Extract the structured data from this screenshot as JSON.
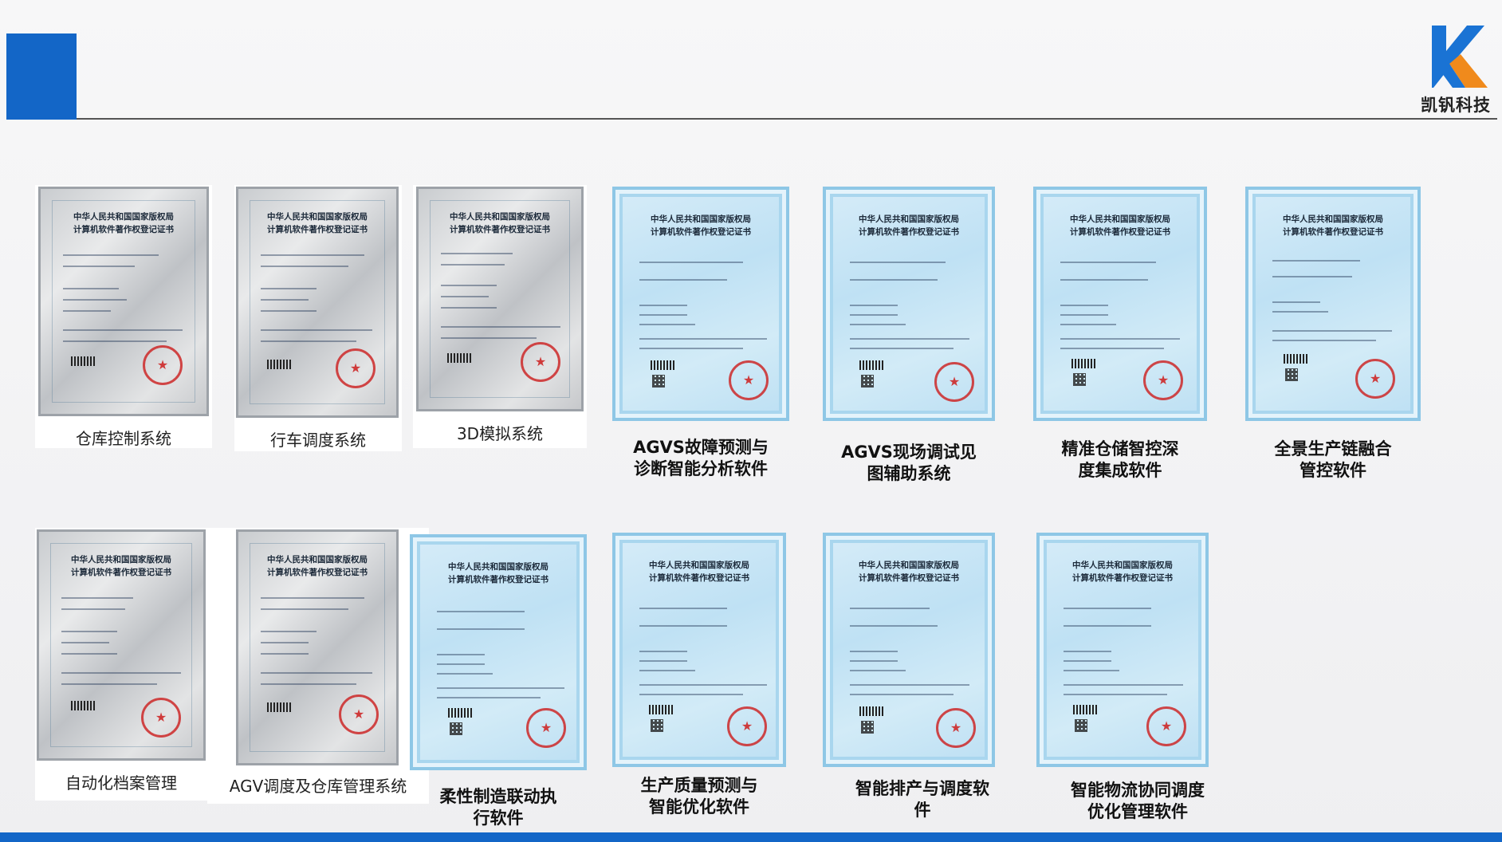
{
  "brand": {
    "logo_text": "凯钒科技",
    "colors": {
      "accent": "#1366c7",
      "logo_blue": "#1a73d4",
      "logo_orange": "#f08a1c"
    }
  },
  "certificates": {
    "gray_title_line1": "中华人民共和国国家版权局",
    "gray_title_line2": "计算机软件著作权登记证书",
    "blue_title_line1": "中华人民共和国国家版权局",
    "blue_title_line2": "计算机软件著作权登记证书",
    "row1": [
      {
        "style": "gray",
        "caption_lines": [
          "仓库控制系统"
        ]
      },
      {
        "style": "gray",
        "caption_lines": [
          "行车调度系统"
        ]
      },
      {
        "style": "gray",
        "caption_lines": [
          "3D模拟系统"
        ]
      },
      {
        "style": "blue",
        "caption_lines": [
          "AGVS故障预测与",
          "诊断智能分析软件"
        ]
      },
      {
        "style": "blue",
        "caption_lines": [
          "AGVS现场调试见",
          "图辅助系统"
        ]
      },
      {
        "style": "blue",
        "caption_lines": [
          "精准仓储智控深",
          "度集成软件"
        ]
      },
      {
        "style": "blue",
        "caption_lines": [
          "全景生产链融合",
          "管控软件"
        ]
      }
    ],
    "row2": [
      {
        "style": "gray",
        "caption_lines": [
          "自动化档案管理"
        ]
      },
      {
        "style": "gray",
        "caption_lines": [
          "AGV调度及仓库管理系统"
        ]
      },
      {
        "style": "blue",
        "caption_lines": [
          "柔性制造联动执",
          "行软件"
        ]
      },
      {
        "style": "blue",
        "caption_lines": [
          "生产质量预测与",
          "智能优化软件"
        ]
      },
      {
        "style": "blue",
        "caption_lines": [
          "智能排产与调度软",
          "件"
        ]
      },
      {
        "style": "blue",
        "caption_lines": [
          "智能物流协同调度",
          "优化管理软件"
        ]
      }
    ]
  }
}
